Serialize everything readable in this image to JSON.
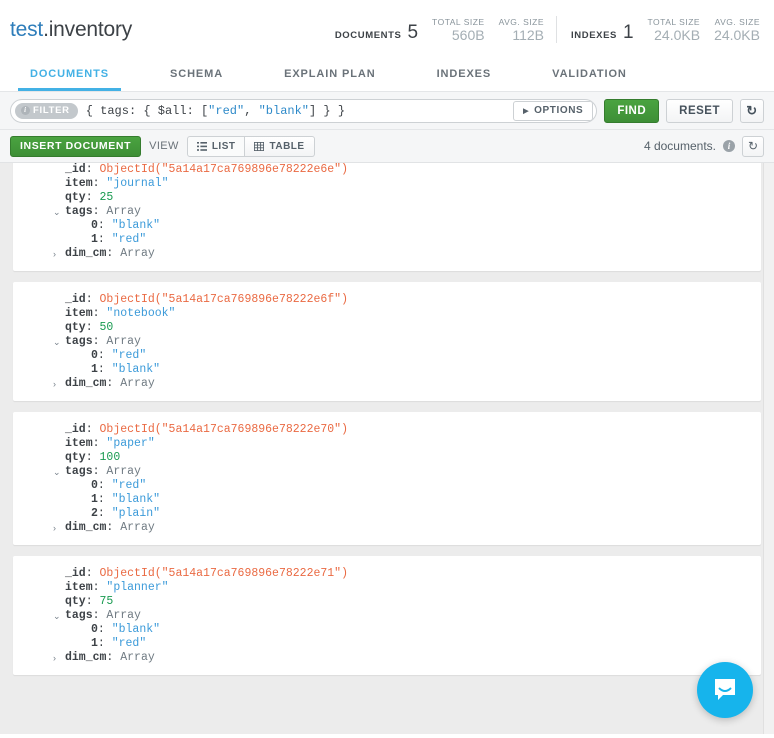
{
  "header": {
    "namespace_db": "test",
    "namespace_coll": ".inventory",
    "stats": [
      {
        "label": "DOCUMENTS",
        "value": "5",
        "sub": [
          {
            "label": "TOTAL SIZE",
            "value": "560B"
          },
          {
            "label": "AVG. SIZE",
            "value": "112B"
          }
        ]
      },
      {
        "label": "INDEXES",
        "value": "1",
        "sub": [
          {
            "label": "TOTAL SIZE",
            "value": "24.0KB"
          },
          {
            "label": "AVG. SIZE",
            "value": "24.0KB"
          }
        ]
      }
    ]
  },
  "tabs": [
    {
      "label": "DOCUMENTS",
      "active": true
    },
    {
      "label": "SCHEMA",
      "active": false
    },
    {
      "label": "EXPLAIN PLAN",
      "active": false
    },
    {
      "label": "INDEXES",
      "active": false
    },
    {
      "label": "VALIDATION",
      "active": false
    }
  ],
  "querybar": {
    "badge_label": "FILTER",
    "badge_icon": "info-icon",
    "filter_value": "{ tags: { $all: [\"red\", \"blank\"] } }",
    "filter_tokens": [
      {
        "t": "{ tags: { $all: [",
        "c": "key"
      },
      {
        "t": "\"red\"",
        "c": "str"
      },
      {
        "t": ", ",
        "c": "key"
      },
      {
        "t": "\"blank\"",
        "c": "str"
      },
      {
        "t": "] } }",
        "c": "key"
      }
    ],
    "options_label": "OPTIONS",
    "find_label": "FIND",
    "reset_label": "RESET",
    "history_icon": "history-icon"
  },
  "toolbar": {
    "insert_label": "INSERT DOCUMENT",
    "view_label": "VIEW",
    "list_label": "LIST",
    "table_label": "TABLE",
    "active_view": "LIST",
    "doc_count_text": "4 documents.",
    "info_icon": "info-icon",
    "refresh_icon": "refresh-icon"
  },
  "documents": [
    {
      "fields": [
        {
          "key": "_id",
          "value": "ObjectId(\"5a14a17ca769896e78222e6e\")",
          "type": "oid",
          "indent": 0,
          "caret": ""
        },
        {
          "key": "item",
          "value": "\"journal\"",
          "type": "str",
          "indent": 0,
          "caret": ""
        },
        {
          "key": "qty",
          "value": "25",
          "type": "num",
          "indent": 0,
          "caret": ""
        },
        {
          "key": "tags",
          "value": "Array",
          "type": "type",
          "indent": 0,
          "caret": "expanded"
        },
        {
          "key": "0",
          "value": "\"blank\"",
          "type": "str",
          "indent": 1,
          "caret": ""
        },
        {
          "key": "1",
          "value": "\"red\"",
          "type": "str",
          "indent": 1,
          "caret": ""
        },
        {
          "key": "dim_cm",
          "value": "Array",
          "type": "type",
          "indent": 0,
          "caret": "collapsed"
        }
      ]
    },
    {
      "fields": [
        {
          "key": "_id",
          "value": "ObjectId(\"5a14a17ca769896e78222e6f\")",
          "type": "oid",
          "indent": 0,
          "caret": ""
        },
        {
          "key": "item",
          "value": "\"notebook\"",
          "type": "str",
          "indent": 0,
          "caret": ""
        },
        {
          "key": "qty",
          "value": "50",
          "type": "num",
          "indent": 0,
          "caret": ""
        },
        {
          "key": "tags",
          "value": "Array",
          "type": "type",
          "indent": 0,
          "caret": "expanded"
        },
        {
          "key": "0",
          "value": "\"red\"",
          "type": "str",
          "indent": 1,
          "caret": ""
        },
        {
          "key": "1",
          "value": "\"blank\"",
          "type": "str",
          "indent": 1,
          "caret": ""
        },
        {
          "key": "dim_cm",
          "value": "Array",
          "type": "type",
          "indent": 0,
          "caret": "collapsed"
        }
      ]
    },
    {
      "fields": [
        {
          "key": "_id",
          "value": "ObjectId(\"5a14a17ca769896e78222e70\")",
          "type": "oid",
          "indent": 0,
          "caret": ""
        },
        {
          "key": "item",
          "value": "\"paper\"",
          "type": "str",
          "indent": 0,
          "caret": ""
        },
        {
          "key": "qty",
          "value": "100",
          "type": "num",
          "indent": 0,
          "caret": ""
        },
        {
          "key": "tags",
          "value": "Array",
          "type": "type",
          "indent": 0,
          "caret": "expanded"
        },
        {
          "key": "0",
          "value": "\"red\"",
          "type": "str",
          "indent": 1,
          "caret": ""
        },
        {
          "key": "1",
          "value": "\"blank\"",
          "type": "str",
          "indent": 1,
          "caret": ""
        },
        {
          "key": "2",
          "value": "\"plain\"",
          "type": "str",
          "indent": 1,
          "caret": ""
        },
        {
          "key": "dim_cm",
          "value": "Array",
          "type": "type",
          "indent": 0,
          "caret": "collapsed"
        }
      ]
    },
    {
      "fields": [
        {
          "key": "_id",
          "value": "ObjectId(\"5a14a17ca769896e78222e71\")",
          "type": "oid",
          "indent": 0,
          "caret": ""
        },
        {
          "key": "item",
          "value": "\"planner\"",
          "type": "str",
          "indent": 0,
          "caret": ""
        },
        {
          "key": "qty",
          "value": "75",
          "type": "num",
          "indent": 0,
          "caret": ""
        },
        {
          "key": "tags",
          "value": "Array",
          "type": "type",
          "indent": 0,
          "caret": "expanded"
        },
        {
          "key": "0",
          "value": "\"blank\"",
          "type": "str",
          "indent": 1,
          "caret": ""
        },
        {
          "key": "1",
          "value": "\"red\"",
          "type": "str",
          "indent": 1,
          "caret": ""
        },
        {
          "key": "dim_cm",
          "value": "Array",
          "type": "type",
          "indent": 0,
          "caret": "collapsed"
        }
      ]
    }
  ],
  "chat": {
    "icon": "chat-bubble-icon"
  },
  "colors": {
    "accent_blue": "#43b1e5",
    "primary_green": "#3e8f36",
    "objectid_orange": "#ea6a43",
    "string_blue": "#3b9ad9",
    "number_green": "#1a9b51",
    "chat_blue": "#16b4ec"
  }
}
